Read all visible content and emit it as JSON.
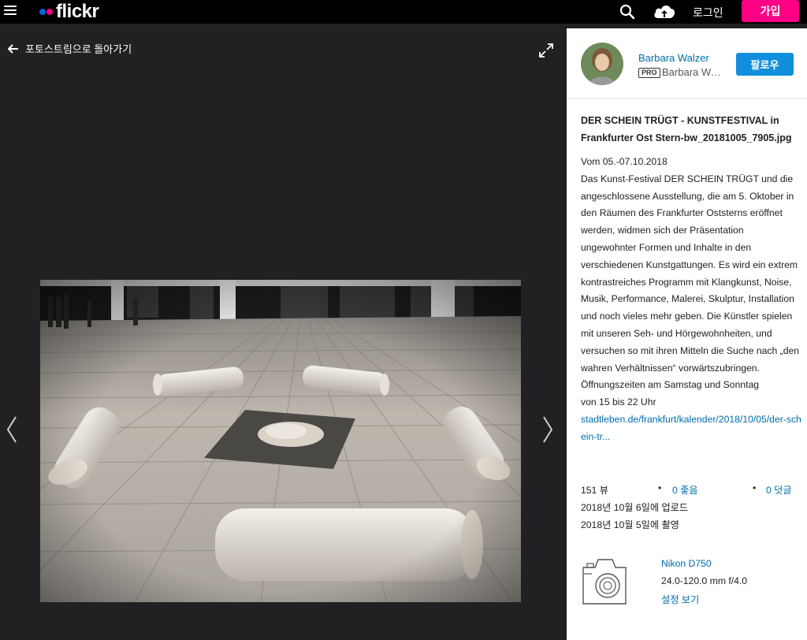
{
  "brand": {
    "logo_text": "flickr"
  },
  "header": {
    "menu_icon": "hamburger-icon",
    "search_icon": "search-icon",
    "upload_icon": "cloud-upload-icon",
    "login_label": "로그인",
    "signup_label": "가입",
    "signup_color": "#ff0084"
  },
  "viewer": {
    "back_label": "포토스트림으로 돌아가기",
    "expand_icon": "expand-icon",
    "prev_icon": "chevron-left-icon",
    "next_icon": "chevron-right-icon"
  },
  "author": {
    "name": "Barbara Walzer",
    "pro_badge": "PRO",
    "sub_name": "Barbara Walzer",
    "follow_label": "팔로우"
  },
  "photo": {
    "title": "DER SCHEIN TRÜGT - KUNSTFESTIVAL in Frankfurter Ost Stern-bw_20181005_7905.jpg",
    "description_lines": [
      "Vom 05.-07.10.2018",
      "Das Kunst-Festival DER SCHEIN TRÜGT und die angeschlossene Ausstellung, die am 5. Oktober in den Räumen des Frankfurter Oststerns eröffnet werden, widmen sich der Präsentation ungewohnter Formen und Inhalte in den verschiedenen Kunstgattungen. Es wird ein extrem kontrastreiches Programm mit Klangkunst, Noise, Musik, Performance, Malerei, Skulptur, Installation und noch vieles mehr geben. Die Künstler spielen mit unseren Seh- und Hörgewohnheiten, und versuchen so mit ihren Mitteln die Suche nach „den wahren Verhältnissen“ vorwärtszubringen.",
      "Öffnungszeiten am Samstag und Sonntag",
      "von 15 bis 22 Uhr"
    ],
    "link_text": "stadtleben.de/frankfurt/kalender/2018/10/05/der-schein-tr...",
    "views": "151 뷰",
    "faves": "0 좋음",
    "comments": "0 덧글",
    "uploaded": "2018년 10월 6일에 업로드",
    "taken": "2018년 10월 5일에 촬영"
  },
  "exif": {
    "camera_icon": "camera-icon",
    "camera": "Nikon D750",
    "lens": "24.0-120.0 mm f/4.0",
    "settings_label": "설정 보기"
  },
  "colors": {
    "link": "#006dac",
    "follow": "#128fdc",
    "viewer_bg": "#212124"
  }
}
